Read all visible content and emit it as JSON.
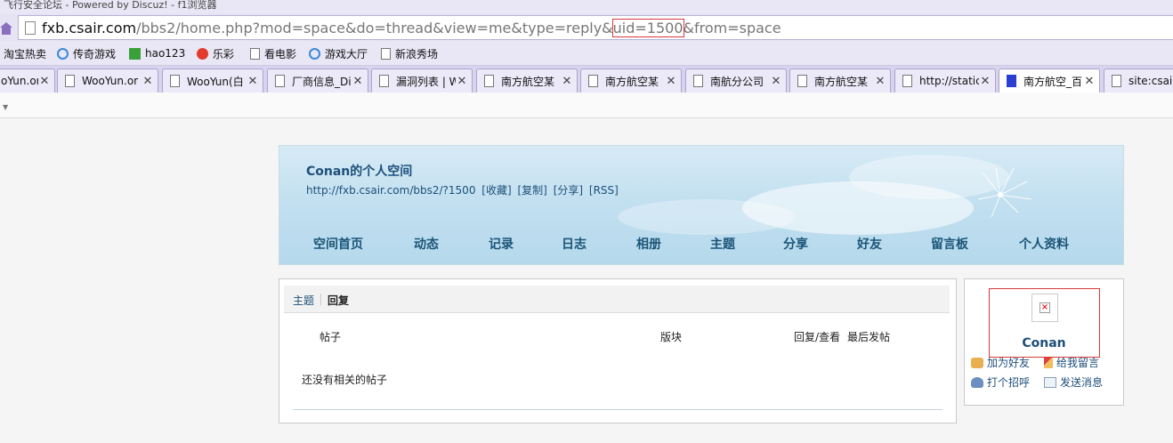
{
  "window": {
    "title": "飞行安全论坛 - Powered by Discuz! - f1浏览器"
  },
  "address_bar": {
    "host": "fxb.csair.com",
    "path_before": "/bbs2/home.php?mod=space&do=thread&view=me&type=reply&",
    "highlight": "uid=1500",
    "path_after": "&from=space"
  },
  "bookmarks": [
    {
      "label": "淘宝热卖",
      "icon": "none"
    },
    {
      "label": "传奇游戏",
      "icon": "ie-icon"
    },
    {
      "label": "hao123",
      "icon": "hao123-icon"
    },
    {
      "label": "乐彩",
      "icon": "lecai-icon"
    },
    {
      "label": "看电影",
      "icon": "page-icon"
    },
    {
      "label": "游戏大厅",
      "icon": "ie-icon"
    },
    {
      "label": "新浪秀场",
      "icon": "page-icon"
    }
  ],
  "tabs": [
    {
      "label": "oYun.or"
    },
    {
      "label": "WooYun.or"
    },
    {
      "label": "WooYun(白"
    },
    {
      "label": "厂商信息_Di"
    },
    {
      "label": "漏洞列表 | W"
    },
    {
      "label": "南方航空某"
    },
    {
      "label": "南方航空某"
    },
    {
      "label": "南航分公司"
    },
    {
      "label": "南方航空某"
    },
    {
      "label": "http://static"
    },
    {
      "label": "南方航空_百"
    },
    {
      "label": "site:csair"
    }
  ],
  "space": {
    "title": "Conan的个人空间",
    "url": "http://fxb.csair.com/bbs2/?1500",
    "links": [
      "[收藏]",
      "[复制]",
      "[分享]",
      "[RSS]"
    ],
    "nav": [
      "空间首页",
      "动态",
      "记录",
      "日志",
      "相册",
      "主题",
      "分享",
      "好友",
      "留言板",
      "个人资料"
    ]
  },
  "thread_list": {
    "tabs": [
      "主题",
      "回复"
    ],
    "active_tab": "回复",
    "columns": [
      "帖子",
      "版块",
      "回复/查看",
      "最后发帖"
    ],
    "empty_text": "还没有相关的帖子"
  },
  "profile": {
    "username": "Conan",
    "actions": [
      "加为好友",
      "给我留言",
      "打个招呼",
      "发送消息"
    ]
  },
  "colors": {
    "link": "#1d4f7a",
    "highlight": "#d9383c",
    "chrome": "#e6e3f4"
  }
}
